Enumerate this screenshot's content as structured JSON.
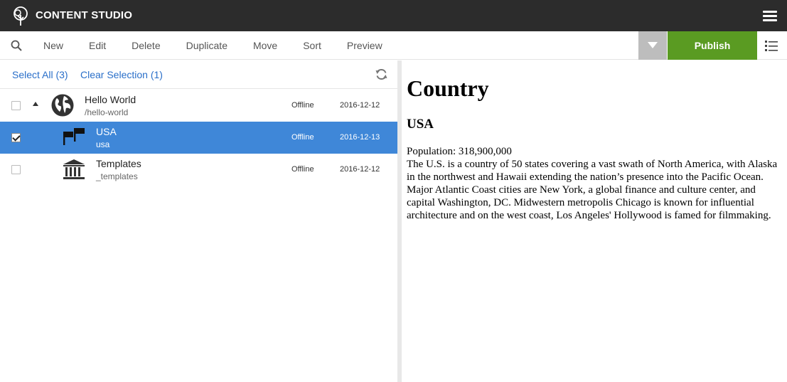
{
  "app": {
    "title": "CONTENT STUDIO",
    "icons": {
      "logo": "tree-logo-icon",
      "menu": "hamburger-icon"
    }
  },
  "toolbar": {
    "actions": [
      "New",
      "Edit",
      "Delete",
      "Duplicate",
      "Move",
      "Sort",
      "Preview"
    ],
    "publish_label": "Publish",
    "icons": {
      "search": "search-icon",
      "dropdown": "triangle-down-icon",
      "view": "list-view-icon"
    },
    "colors": {
      "publish": "#5a9b22",
      "dropdown": "#bdbdbd"
    }
  },
  "selection": {
    "select_all": "Select All (3)",
    "clear_selection": "Clear Selection (1)"
  },
  "content_items": [
    {
      "name": "Hello World",
      "path": "/hello-world",
      "status": "Offline",
      "date": "2016-12-12",
      "icon": "globe-icon",
      "checked": false,
      "expanded": true,
      "selected": false
    },
    {
      "name": "USA",
      "path": "usa",
      "status": "Offline",
      "date": "2016-12-13",
      "icon": "flags-icon",
      "checked": true,
      "selected": true
    },
    {
      "name": "Templates",
      "path": "_templates",
      "status": "Offline",
      "date": "2016-12-12",
      "icon": "building-icon",
      "checked": false,
      "selected": false
    }
  ],
  "preview": {
    "heading": "Country",
    "subheading": "USA",
    "population": "Population: 318,900,000",
    "description": "The U.S. is a country of 50 states covering a vast swath of North America, with Alaska in the northwest and Hawaii extending the nation’s presence into the Pacific Ocean. Major Atlantic Coast cities are New York, a global finance and culture center, and capital Washington, DC. Midwestern metropolis Chicago is known for influential architecture and on the west coast, Los Angeles' Hollywood is famed for filmmaking."
  },
  "colors": {
    "appbar": "#2c2c2c",
    "selected_row": "#3f87d8",
    "link": "#2a6fc9"
  }
}
